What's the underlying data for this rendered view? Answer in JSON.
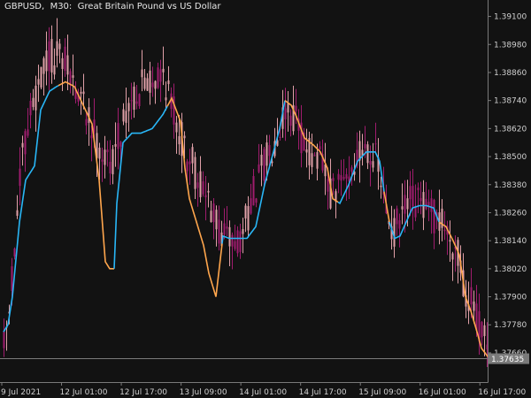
{
  "window": {
    "symbol": "GBPUSD",
    "timeframe": "M30",
    "description": "Great Britain Pound vs US Dollar",
    "title_separator": ",  ",
    "title_colon": ":  "
  },
  "colors": {
    "background": "#121212",
    "axis_line": "#7a7a7a",
    "bull_candle": "#e0a0a8",
    "bear_candle": "#a01c6e",
    "line_up": "#29b6f6",
    "line_down": "#ffa64d",
    "bid_line": "#7a7a7a",
    "bid_label_bg": "#7a7a7a",
    "bid_label_text": "#ffffff"
  },
  "chart_data": {
    "type": "candlestick",
    "symbol": "GBPUSD",
    "timeframe": "M30",
    "ylim": [
      1.3755,
      1.3914
    ],
    "y_ticks": [
      "1.39100",
      "1.38980",
      "1.38860",
      "1.38740",
      "1.38620",
      "1.38500",
      "1.38380",
      "1.38260",
      "1.38140",
      "1.38020",
      "1.37900",
      "1.37780",
      "1.37660"
    ],
    "x_ticks": [
      "9 Jul 2021",
      "12 Jul 01:00",
      "12 Jul 17:00",
      "13 Jul 09:00",
      "14 Jul 01:00",
      "14 Jul 17:00",
      "15 Jul 09:00",
      "16 Jul 01:00",
      "16 Jul 17:00"
    ],
    "current_price": "1.37635",
    "price_path": [
      [
        0,
        1.3768
      ],
      [
        5,
        1.378
      ],
      [
        12,
        1.3812
      ],
      [
        20,
        1.3846
      ],
      [
        30,
        1.387
      ],
      [
        40,
        1.388
      ],
      [
        50,
        1.3893
      ],
      [
        60,
        1.3892
      ],
      [
        70,
        1.3889
      ],
      [
        80,
        1.388
      ],
      [
        90,
        1.3872
      ],
      [
        100,
        1.3862
      ],
      [
        110,
        1.3852
      ],
      [
        120,
        1.3845
      ],
      [
        130,
        1.386
      ],
      [
        140,
        1.3871
      ],
      [
        150,
        1.3878
      ],
      [
        160,
        1.3881
      ],
      [
        170,
        1.3884
      ],
      [
        180,
        1.3886
      ],
      [
        190,
        1.3872
      ],
      [
        200,
        1.3858
      ],
      [
        210,
        1.3849
      ],
      [
        220,
        1.384
      ],
      [
        230,
        1.3832
      ],
      [
        240,
        1.382
      ],
      [
        250,
        1.3815
      ],
      [
        260,
        1.3815
      ],
      [
        270,
        1.3818
      ],
      [
        280,
        1.3832
      ],
      [
        290,
        1.3842
      ],
      [
        300,
        1.3852
      ],
      [
        310,
        1.3862
      ],
      [
        320,
        1.3872
      ],
      [
        330,
        1.3866
      ],
      [
        340,
        1.3855
      ],
      [
        350,
        1.385
      ],
      [
        360,
        1.3845
      ],
      [
        370,
        1.3832
      ],
      [
        380,
        1.3838
      ],
      [
        390,
        1.3844
      ],
      [
        400,
        1.3849
      ],
      [
        410,
        1.3856
      ],
      [
        420,
        1.3848
      ],
      [
        430,
        1.383
      ],
      [
        440,
        1.3817
      ],
      [
        450,
        1.3825
      ],
      [
        460,
        1.383
      ],
      [
        470,
        1.383
      ],
      [
        480,
        1.3826
      ],
      [
        490,
        1.3824
      ],
      [
        500,
        1.3818
      ],
      [
        510,
        1.3812
      ],
      [
        520,
        1.3794
      ],
      [
        530,
        1.3786
      ],
      [
        540,
        1.3774
      ],
      [
        548,
        1.3764
      ]
    ],
    "smooth_line": [
      [
        0,
        1.3775
      ],
      [
        5,
        1.3778
      ],
      [
        10,
        1.379
      ],
      [
        18,
        1.3822
      ],
      [
        25,
        1.384
      ],
      [
        35,
        1.3846
      ],
      [
        42,
        1.387
      ],
      [
        52,
        1.3878
      ],
      [
        60,
        1.388
      ],
      [
        70,
        1.3882
      ],
      [
        80,
        1.388
      ],
      [
        90,
        1.3872
      ],
      [
        100,
        1.3864
      ],
      [
        108,
        1.384
      ],
      [
        115,
        1.3805
      ],
      [
        120,
        1.3802
      ],
      [
        125,
        1.3802
      ],
      [
        128,
        1.383
      ],
      [
        135,
        1.3856
      ],
      [
        145,
        1.386
      ],
      [
        155,
        1.386
      ],
      [
        168,
        1.3862
      ],
      [
        180,
        1.3868
      ],
      [
        190,
        1.3875
      ],
      [
        200,
        1.3865
      ],
      [
        205,
        1.3845
      ],
      [
        210,
        1.3832
      ],
      [
        218,
        1.3822
      ],
      [
        226,
        1.3812
      ],
      [
        232,
        1.38
      ],
      [
        240,
        1.379
      ],
      [
        248,
        1.3816
      ],
      [
        255,
        1.3815
      ],
      [
        265,
        1.3815
      ],
      [
        275,
        1.3815
      ],
      [
        285,
        1.382
      ],
      [
        295,
        1.3838
      ],
      [
        305,
        1.3852
      ],
      [
        312,
        1.3862
      ],
      [
        318,
        1.3874
      ],
      [
        325,
        1.3872
      ],
      [
        330,
        1.3868
      ],
      [
        340,
        1.3858
      ],
      [
        350,
        1.3855
      ],
      [
        358,
        1.3852
      ],
      [
        366,
        1.3845
      ],
      [
        372,
        1.3832
      ],
      [
        380,
        1.383
      ],
      [
        390,
        1.3838
      ],
      [
        400,
        1.3848
      ],
      [
        410,
        1.3852
      ],
      [
        420,
        1.3852
      ],
      [
        425,
        1.3848
      ],
      [
        430,
        1.3835
      ],
      [
        436,
        1.3822
      ],
      [
        442,
        1.3815
      ],
      [
        448,
        1.3816
      ],
      [
        455,
        1.3822
      ],
      [
        462,
        1.3828
      ],
      [
        470,
        1.3829
      ],
      [
        478,
        1.3829
      ],
      [
        486,
        1.3828
      ],
      [
        492,
        1.3822
      ],
      [
        500,
        1.382
      ],
      [
        508,
        1.3814
      ],
      [
        515,
        1.3808
      ],
      [
        522,
        1.379
      ],
      [
        528,
        1.3784
      ],
      [
        535,
        1.3775
      ],
      [
        540,
        1.3768
      ],
      [
        548,
        1.3764
      ]
    ],
    "line_color_spans": [
      {
        "from": 0,
        "to": 62,
        "color_key": "line_up"
      },
      {
        "from": 62,
        "to": 125,
        "color_key": "line_down"
      },
      {
        "from": 125,
        "to": 185,
        "color_key": "line_up"
      },
      {
        "from": 185,
        "to": 247,
        "color_key": "line_down"
      },
      {
        "from": 247,
        "to": 318,
        "color_key": "line_up"
      },
      {
        "from": 318,
        "to": 378,
        "color_key": "line_down"
      },
      {
        "from": 378,
        "to": 430,
        "color_key": "line_up"
      },
      {
        "from": 430,
        "to": 436,
        "color_key": "line_down"
      },
      {
        "from": 436,
        "to": 492,
        "color_key": "line_up"
      },
      {
        "from": 492,
        "to": 548,
        "color_key": "line_down"
      }
    ]
  }
}
